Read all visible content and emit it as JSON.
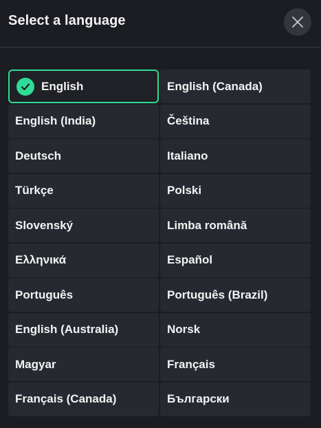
{
  "header": {
    "title": "Select a language",
    "close_icon": "close-icon"
  },
  "colors": {
    "background": "#1b1d22",
    "item_background": "#262930",
    "accent": "#2fdc95",
    "close_button": "#33363d"
  },
  "languages": {
    "items": [
      {
        "label": "English",
        "selected": true
      },
      {
        "label": "English (Canada)",
        "selected": false
      },
      {
        "label": "English (India)",
        "selected": false
      },
      {
        "label": "Čeština",
        "selected": false
      },
      {
        "label": "Deutsch",
        "selected": false
      },
      {
        "label": "Italiano",
        "selected": false
      },
      {
        "label": "Türkçe",
        "selected": false
      },
      {
        "label": "Polski",
        "selected": false
      },
      {
        "label": "Slovenský",
        "selected": false
      },
      {
        "label": "Limba română",
        "selected": false
      },
      {
        "label": "Ελληνικά",
        "selected": false
      },
      {
        "label": "Español",
        "selected": false
      },
      {
        "label": "Português",
        "selected": false
      },
      {
        "label": "Português (Brazil)",
        "selected": false
      },
      {
        "label": "English (Australia)",
        "selected": false
      },
      {
        "label": "Norsk",
        "selected": false
      },
      {
        "label": "Magyar",
        "selected": false
      },
      {
        "label": "Français",
        "selected": false
      },
      {
        "label": "Français (Canada)",
        "selected": false
      },
      {
        "label": "Български",
        "selected": false
      }
    ],
    "selected_icon": "check-circle-icon"
  }
}
